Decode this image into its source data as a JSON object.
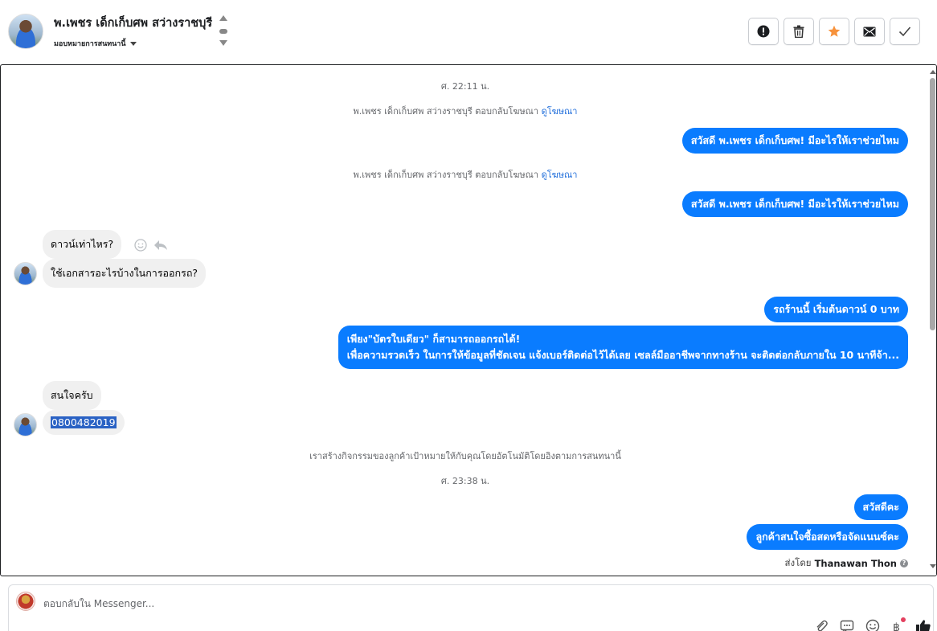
{
  "header": {
    "contact_name": "พ.เพชร เด็กเก็บศพ สว่างราชบุรี",
    "assign_label": "มอบหมายการสนทนานี้",
    "actions": [
      {
        "name": "mark-spam-button",
        "icon": "exclamation-icon"
      },
      {
        "name": "delete-button",
        "icon": "trash-icon"
      },
      {
        "name": "star-button",
        "icon": "star-icon",
        "color": "#f7923b"
      },
      {
        "name": "mark-unread-button",
        "icon": "envelope-icon"
      },
      {
        "name": "mark-done-button",
        "icon": "checkmark-icon"
      }
    ]
  },
  "conversation": {
    "timestamp_1": "ศ. 22:11 น.",
    "ad_reply_1": {
      "text": "พ.เพชร เด็กเก็บศพ สว่างราชบุรี ตอบกลับโฆษณา",
      "link": "ดูโฆษณา"
    },
    "auto_reply_1": "สวัสดี พ.เพชร เด็กเก็บศพ! มีอะไรให้เราช่วยไหม",
    "ad_reply_2": {
      "text": "พ.เพชร เด็กเก็บศพ สว่างราชบุรี ตอบกลับโฆษณา",
      "link": "ดูโฆษณา"
    },
    "auto_reply_2": "สวัสดี พ.เพชร เด็กเก็บศพ! มีอะไรให้เราช่วยไหม",
    "incoming_1": "ดาวน์เท่าไหร?",
    "incoming_2": "ใช้เอกสารอะไรบ้างในการออกรถ?",
    "outgoing_1": "รถร้านนี้ เริ่มต้นดาวน์ 0 บาท",
    "outgoing_2_line1": "เพียง\"บัตรใบเดียว\" ก็สามารถออกรถได้!",
    "outgoing_2_line2": "เพื่อความรวดเร็ว ในการให้ข้อมูลที่ชัดเจน แจ้งเบอร์ติดต่อไว้ได้เลย เซลล์มืออาชีพจากทางร้าน จะติดต่อกลับภายใน 10 นาทีจ้า...",
    "incoming_3": "สนใจครับ",
    "incoming_4": "0800482019",
    "activity_note": "เราสร้างกิจกรรมของลูกค้าเป้าหมายให้กับคุณโดยอัตโนมัติโดยอิงตามการสนทนานี้",
    "timestamp_2": "ศ. 23:38 น.",
    "outgoing_3": "สวัสดีคะ",
    "outgoing_4": "ลูกค้าสนใจซื้อสดหรือจัดแนนซ์คะ",
    "sent_by_label": "ส่งโดย",
    "sent_by_name": "Thanawan Thon",
    "bubble_color": "#0a7cff"
  },
  "composer": {
    "placeholder": "ตอบกลับใน Messenger...",
    "tools": [
      "attachment-icon",
      "saved-reply-icon",
      "emoji-icon",
      "payment-icon",
      "like-icon"
    ]
  }
}
